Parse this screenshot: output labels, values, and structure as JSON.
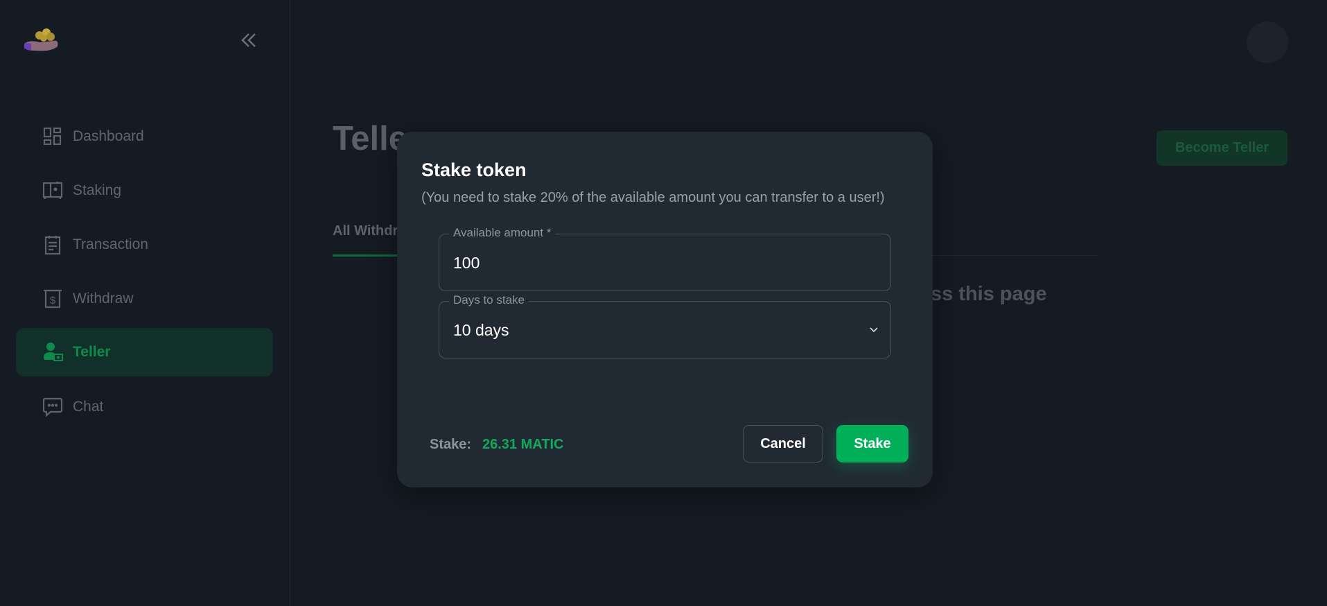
{
  "sidebar": {
    "items": [
      {
        "label": "Dashboard",
        "icon": "dashboard-icon"
      },
      {
        "label": "Staking",
        "icon": "safe-icon"
      },
      {
        "label": "Transaction",
        "icon": "clipboard-icon"
      },
      {
        "label": "Withdraw",
        "icon": "withdraw-icon"
      },
      {
        "label": "Teller",
        "icon": "teller-icon",
        "active": true
      },
      {
        "label": "Chat",
        "icon": "chat-icon"
      }
    ]
  },
  "page": {
    "title": "Telle",
    "become_teller": "Become Teller",
    "tab": "All Withdr",
    "message_fragment": "ss this page"
  },
  "modal": {
    "title": "Stake token",
    "subtitle": "(You need to stake 20% of the available amount you can transfer to a user!)",
    "amount_label": "Available amount *",
    "amount_value": "100",
    "days_label": "Days to stake",
    "days_value": "10 days",
    "stake_label": "Stake:",
    "stake_value": "26.31 MATIC",
    "cancel": "Cancel",
    "stake": "Stake"
  },
  "colors": {
    "accent": "#03b05a",
    "modal_bg": "#212a33",
    "page_bg": "#151b23"
  }
}
